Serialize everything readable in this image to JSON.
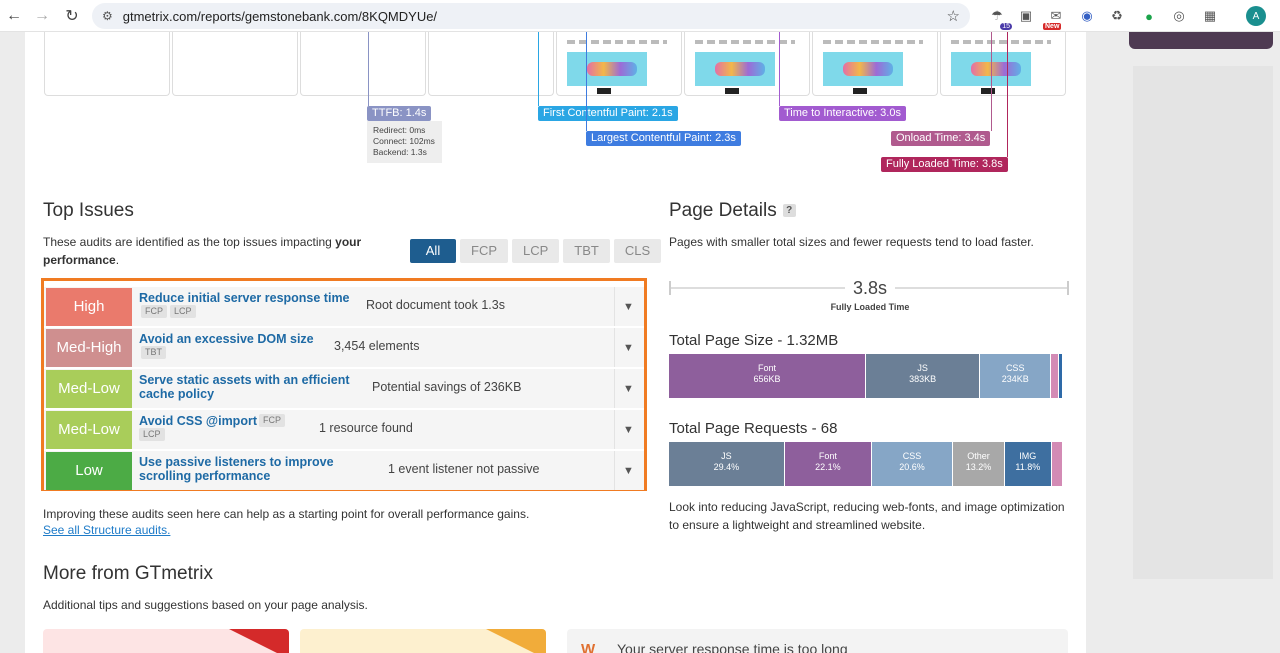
{
  "browser": {
    "url": "gtmetrix.com/reports/gemstonebank.com/8KQMDYUe/",
    "ext_badge_count": "15",
    "ext_new_label": "New",
    "avatar_letter": "A"
  },
  "waterfall": {
    "ttfb": "TTFB: 1.4s",
    "ttfb_details": [
      "Redirect: 0ms",
      "Connect: 102ms",
      "Backend: 1.3s"
    ],
    "fcp": "First Contentful Paint: 2.1s",
    "lcp": "Largest Contentful Paint: 2.3s",
    "tti": "Time to Interactive: 3.0s",
    "onload": "Onload Time: 3.4s",
    "fully_loaded": "Fully Loaded Time: 3.8s",
    "colors": {
      "ttfb": "#8a93c4",
      "fcp": "#2aa6e4",
      "lcp": "#3e7ce0",
      "tti": "#a25bd0",
      "onload": "#b05a8e",
      "fully": "#b0265c"
    }
  },
  "top_issues": {
    "title": "Top Issues",
    "desc_prefix": "These audits are identified as the top issues impacting ",
    "desc_bold1": "your",
    "desc_bold2": "performance",
    "desc_suffix": ".",
    "filters": [
      "All",
      "FCP",
      "LCP",
      "TBT",
      "CLS"
    ],
    "issues": [
      {
        "severity": "High",
        "color": "#ea7a6c",
        "title": "Reduce initial server response time",
        "badges": [
          "FCP",
          "LCP"
        ],
        "result": "Root document took 1.3s"
      },
      {
        "severity": "Med-High",
        "color": "#cf8f8f",
        "title": "Avoid an excessive DOM size",
        "badges": [
          "TBT"
        ],
        "result": "3,454 elements"
      },
      {
        "severity": "Med-Low",
        "color": "#a9cd5a",
        "title_l1": "Serve static assets with an efficient",
        "title_l2": "cache policy",
        "result": "Potential savings of 236KB"
      },
      {
        "severity": "Med-Low",
        "color": "#a9cd5a",
        "title": "Avoid CSS @import",
        "badges": [
          "FCP",
          "LCP"
        ],
        "result": "1 resource found"
      },
      {
        "severity": "Low",
        "color": "#4cab45",
        "title_l1": "Use passive listeners to improve",
        "title_l2": "scrolling performance",
        "result": "1 event listener not passive"
      }
    ],
    "footer": "Improving these audits seen here can help as a starting point for overall performance gains.",
    "link": "See all Structure audits."
  },
  "page_details": {
    "title": "Page Details",
    "help": "?",
    "desc": "Pages with smaller total sizes and fewer requests tend to load faster.",
    "fully_loaded_value": "3.8s",
    "fully_loaded_label": "Fully Loaded Time",
    "size_title": "Total Page Size - 1.32MB",
    "size_segments": [
      {
        "name": "Font",
        "value": "656KB",
        "share": 0.5,
        "color": "#8e5f9c"
      },
      {
        "name": "JS",
        "value": "383KB",
        "share": 0.29,
        "color": "#6b7f96"
      },
      {
        "name": "CSS",
        "value": "234KB",
        "share": 0.18,
        "color": "#86a6c6"
      },
      {
        "name": "",
        "value": "",
        "share": 0.02,
        "color": "#d38bb5"
      },
      {
        "name": "",
        "value": "",
        "share": 0.01,
        "color": "#2e6aa8"
      }
    ],
    "requests_title": "Total Page Requests - 68",
    "request_segments": [
      {
        "name": "JS",
        "value": "29.4%",
        "share": 0.294,
        "color": "#6b7f96"
      },
      {
        "name": "Font",
        "value": "22.1%",
        "share": 0.221,
        "color": "#8e5f9c"
      },
      {
        "name": "CSS",
        "value": "20.6%",
        "share": 0.206,
        "color": "#86a6c6"
      },
      {
        "name": "Other",
        "value": "13.2%",
        "share": 0.132,
        "color": "#a8a8a8"
      },
      {
        "name": "IMG",
        "value": "11.8%",
        "share": 0.118,
        "color": "#3e6fa0"
      },
      {
        "name": "",
        "value": "",
        "share": 0.029,
        "color": "#d38bb5"
      }
    ],
    "footer": "Look into reducing JavaScript, reducing web-fonts, and image optimization to ensure a lightweight and streamlined website."
  },
  "more": {
    "title": "More from GTmetrix",
    "desc": "Additional tips and suggestions based on your page analysis.",
    "card3_text": "Your server response time is too long"
  }
}
